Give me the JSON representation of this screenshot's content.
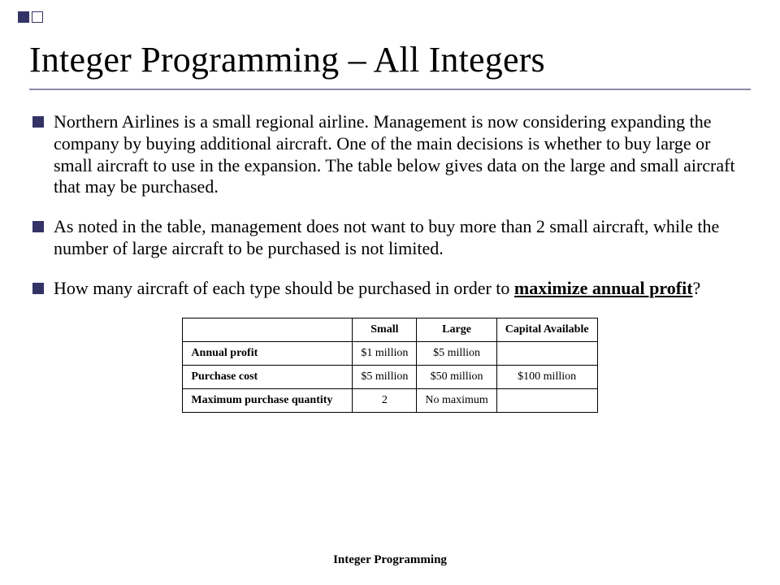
{
  "title": "Integer Programming – All Integers",
  "bullets": [
    {
      "text": "Northern Airlines is a small regional airline.  Management is now considering expanding the company by buying additional aircraft.  One of the main decisions is whether to buy large or small aircraft to use in the expansion.  The table below gives data on the large and small aircraft that may be purchased."
    },
    {
      "text": "As noted in the table, management does not want to buy more than 2 small aircraft, while the number of large aircraft to be purchased is not limited."
    },
    {
      "text_prefix": "How many aircraft of each type should be purchased in order to ",
      "emph": "maximize annual profit",
      "text_suffix": "?"
    }
  ],
  "table": {
    "headers": [
      "",
      "Small",
      "Large",
      "Capital Available"
    ],
    "rows": [
      {
        "label": "Annual profit",
        "small": "$1 million",
        "large": "$5  million",
        "cap": ""
      },
      {
        "label": "Purchase cost",
        "small": "$5 million",
        "large": "$50 million",
        "cap": "$100 million"
      },
      {
        "label": "Maximum purchase quantity",
        "small": "2",
        "large": "No maximum",
        "cap": ""
      }
    ]
  },
  "footer": "Integer Programming"
}
